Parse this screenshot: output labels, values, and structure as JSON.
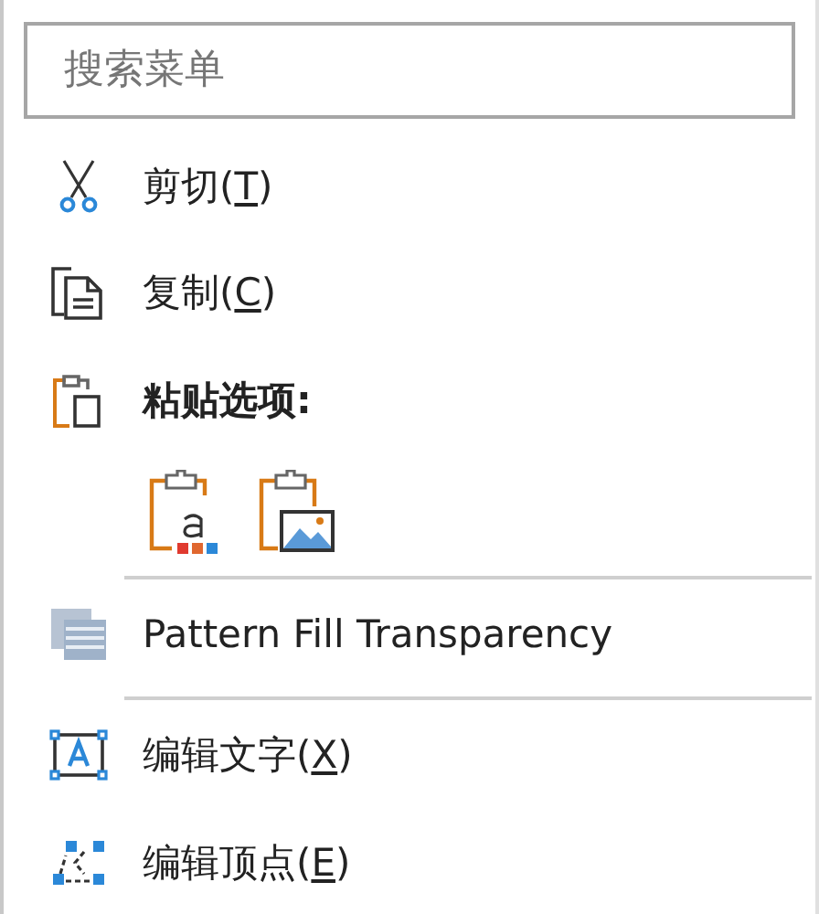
{
  "search": {
    "placeholder": "搜索菜单"
  },
  "items": [
    {
      "kind": "command",
      "prefix": "剪切(",
      "key": "T",
      "suffix": ")"
    },
    {
      "kind": "command",
      "prefix": "复制(",
      "key": "C",
      "suffix": ")"
    },
    {
      "kind": "header",
      "text": "粘贴选项:"
    },
    {
      "kind": "paste-options",
      "options": [
        {
          "kind": "keep-text"
        },
        {
          "kind": "picture"
        }
      ]
    },
    {
      "kind": "separator"
    },
    {
      "kind": "plain",
      "text": "Pattern Fill Transparency"
    },
    {
      "kind": "separator"
    },
    {
      "kind": "command",
      "prefix": "编辑文字(",
      "key": "X",
      "suffix": ")"
    },
    {
      "kind": "command",
      "prefix": "编辑顶点(",
      "key": "E",
      "suffix": ")"
    }
  ]
}
